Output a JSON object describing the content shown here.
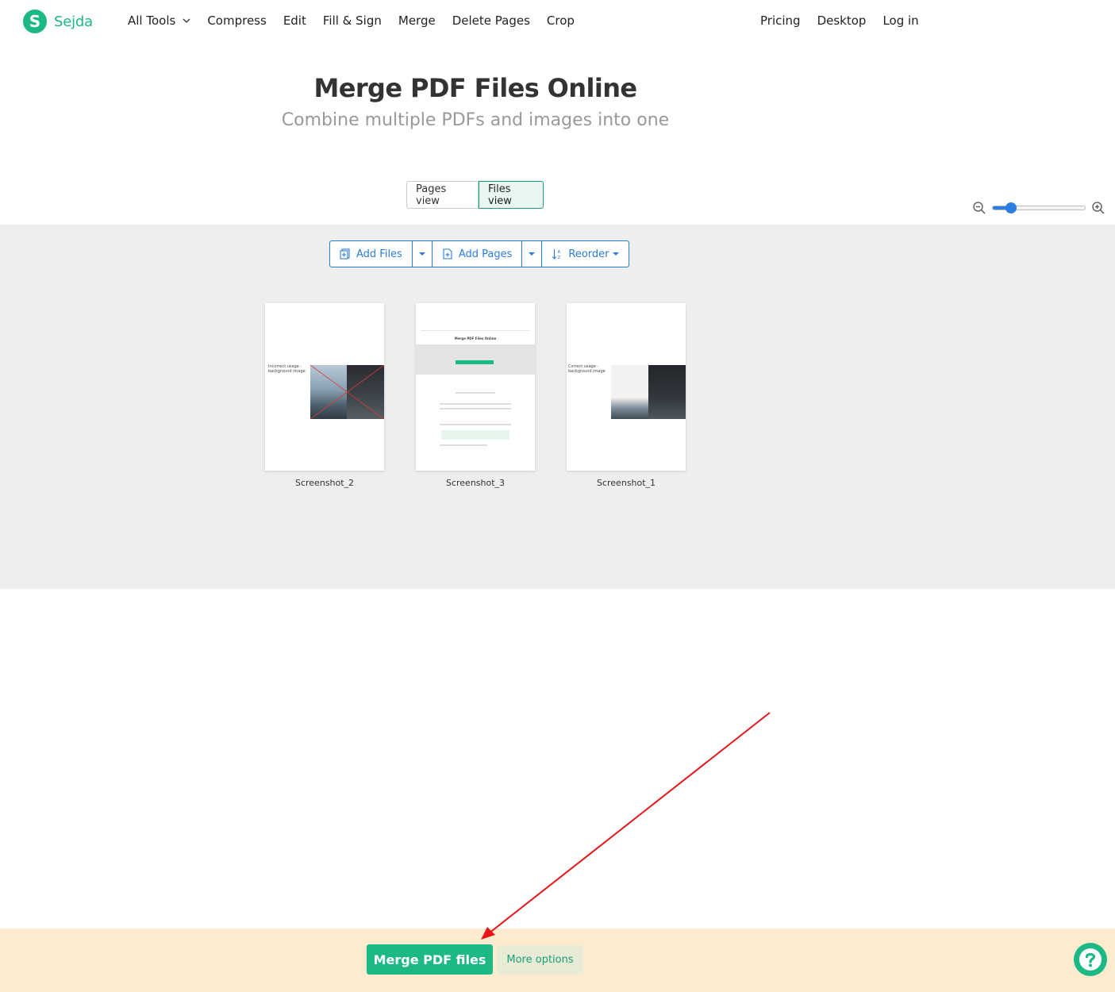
{
  "header": {
    "logo_letter": "S",
    "logo_text": "Sejda",
    "nav_left": [
      "All Tools",
      "Compress",
      "Edit",
      "Fill & Sign",
      "Merge",
      "Delete Pages",
      "Crop"
    ],
    "nav_right": [
      "Pricing",
      "Desktop",
      "Log in"
    ]
  },
  "hero": {
    "title": "Merge PDF Files Online",
    "subtitle": "Combine multiple PDFs and images into one"
  },
  "view_toggle": {
    "pages_view": "Pages view",
    "files_view": "Files view",
    "active": "Files view"
  },
  "zoom": {
    "level": 0.2
  },
  "toolbar": {
    "add_files": "Add Files",
    "add_pages": "Add Pages",
    "reorder": "Reorder"
  },
  "files": [
    {
      "name": "Screenshot_2",
      "caption": "Incorrect usage - background image"
    },
    {
      "name": "Screenshot_3",
      "caption": "Merge PDF Files Online"
    },
    {
      "name": "Screenshot_1",
      "caption": "Correct usage - background image"
    }
  ],
  "bottom": {
    "merge_label": "Merge PDF files",
    "more_label": "More options"
  },
  "colors": {
    "brand": "#1cb886",
    "link_blue": "#2b7de0",
    "bottom_bar": "#fdebd0",
    "annotation_arrow": "#e8161b"
  }
}
